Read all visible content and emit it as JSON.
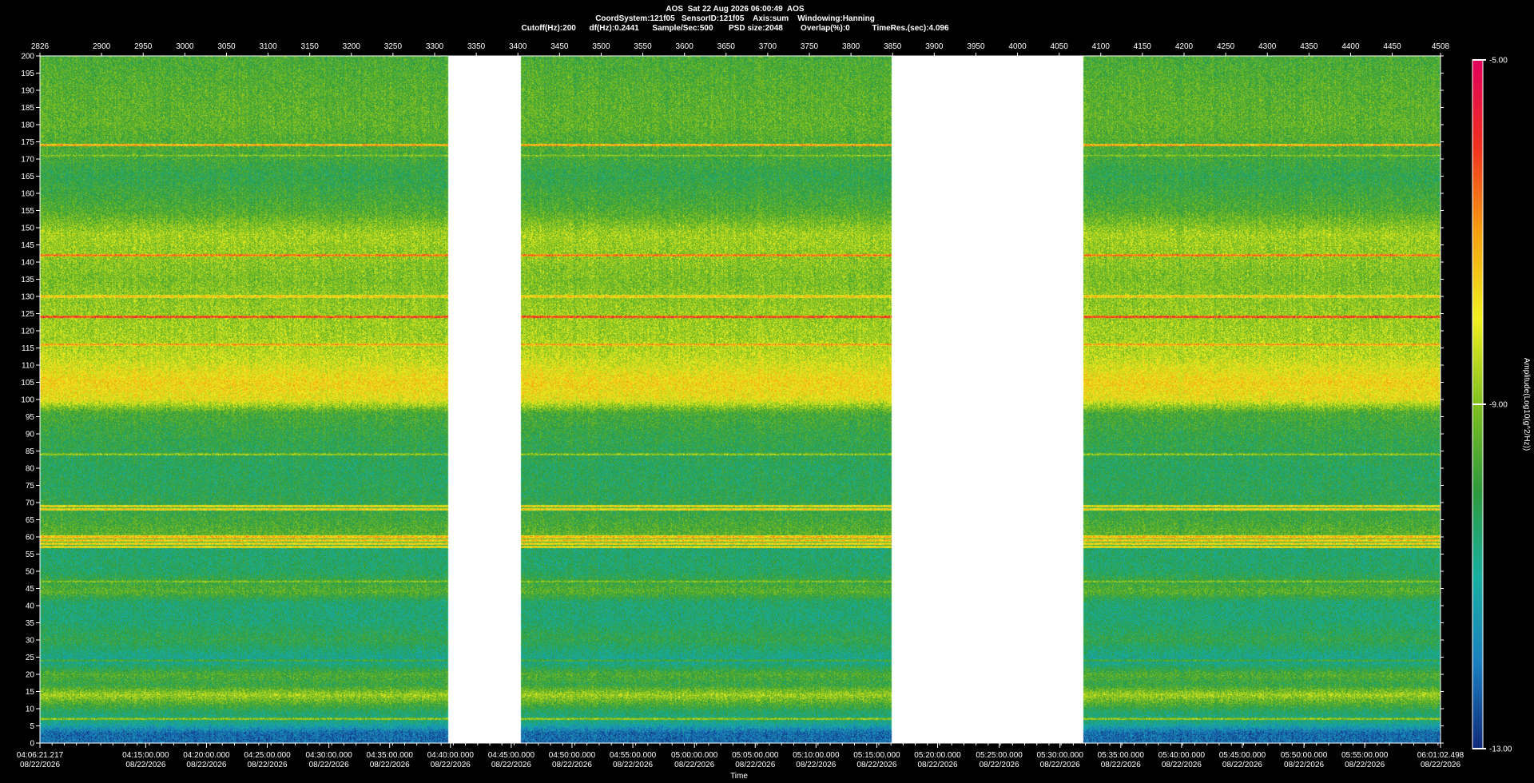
{
  "header": {
    "line1": "AOS  Sat 22 Aug 2026 06:00:49  AOS",
    "line2": "CoordSystem:121f05   SensorID:121f05    Axis:sum    Windowing:Hanning",
    "line3": "Cutoff(Hz):200      df(Hz):0.2441      Sample/Sec:500       PSD size:2048        Overlap(%):0          TimeRes.(sec):4.096"
  },
  "chart_data": {
    "type": "heatmap",
    "title": "AOS  Sat 22 Aug 2026 06:00:49  AOS",
    "xlabel": "Time",
    "ylabel": "",
    "colorbar_label": "Amplitude(Log10(g^2/Hz))",
    "ylim": [
      0,
      200
    ],
    "y_ticks": [
      0,
      5,
      10,
      15,
      20,
      25,
      30,
      35,
      40,
      45,
      50,
      55,
      60,
      65,
      70,
      75,
      80,
      85,
      90,
      95,
      100,
      105,
      110,
      115,
      120,
      125,
      130,
      135,
      140,
      145,
      150,
      155,
      160,
      165,
      170,
      175,
      180,
      185,
      190,
      195,
      200
    ],
    "x_top_range": [
      2826,
      4508
    ],
    "x_top_ticks": [
      "2826",
      "2900",
      "2950",
      "3000",
      "3050",
      "3100",
      "3150",
      "3200",
      "3250",
      "3300",
      "3350",
      "3400",
      "3450",
      "3500",
      "3550",
      "3600",
      "3650",
      "3700",
      "3750",
      "3800",
      "3850",
      "3900",
      "3950",
      "4000",
      "4050",
      "4100",
      "4150",
      "4200",
      "4250",
      "4300",
      "4350",
      "4400",
      "4450",
      "4508"
    ],
    "time_ticks": [
      {
        "time": "04:06:21.217",
        "date": "08/22/2026",
        "index": 2826
      },
      {
        "time": "04:15:00.000",
        "date": "08/22/2026",
        "index": 2953
      },
      {
        "time": "04:20:00.000",
        "date": "08/22/2026",
        "index": 3026
      },
      {
        "time": "04:25:00.000",
        "date": "08/22/2026",
        "index": 3099
      },
      {
        "time": "04:30:00.000",
        "date": "08/22/2026",
        "index": 3173
      },
      {
        "time": "04:35:00.000",
        "date": "08/22/2026",
        "index": 3246
      },
      {
        "time": "04:40:00.000",
        "date": "08/22/2026",
        "index": 3319
      },
      {
        "time": "04:45:00.000",
        "date": "08/22/2026",
        "index": 3392
      },
      {
        "time": "04:50:00.000",
        "date": "08/22/2026",
        "index": 3465
      },
      {
        "time": "04:55:00.000",
        "date": "08/22/2026",
        "index": 3538
      },
      {
        "time": "05:00:00.000",
        "date": "08/22/2026",
        "index": 3612
      },
      {
        "time": "05:05:00.000",
        "date": "08/22/2026",
        "index": 3685
      },
      {
        "time": "05:10:00.000",
        "date": "08/22/2026",
        "index": 3758
      },
      {
        "time": "05:15:00.000",
        "date": "08/22/2026",
        "index": 3831
      },
      {
        "time": "05:20:00.000",
        "date": "08/22/2026",
        "index": 3904
      },
      {
        "time": "05:25:00.000",
        "date": "08/22/2026",
        "index": 3978
      },
      {
        "time": "05:30:00.000",
        "date": "08/22/2026",
        "index": 4051
      },
      {
        "time": "05:35:00.000",
        "date": "08/22/2026",
        "index": 4124
      },
      {
        "time": "05:40:00.000",
        "date": "08/22/2026",
        "index": 4197
      },
      {
        "time": "05:45:00.000",
        "date": "08/22/2026",
        "index": 4270
      },
      {
        "time": "05:50:00.000",
        "date": "08/22/2026",
        "index": 4344
      },
      {
        "time": "05:55:00.000",
        "date": "08/22/2026",
        "index": 4417
      },
      {
        "time": "06:01:02.498",
        "date": "08/22/2026",
        "index": 4508
      }
    ],
    "data_gaps": [
      [
        3316,
        3403
      ],
      [
        3848,
        4079
      ]
    ],
    "color_scale": {
      "min": -13.0,
      "max": -5.0,
      "ticks": [
        "-5.00",
        "-9.00",
        "-13.00"
      ],
      "colors": [
        "#102a7a",
        "#1a7fc0",
        "#18b0a0",
        "#2e9a3c",
        "#80c020",
        "#f2f020",
        "#f5a010",
        "#f03020",
        "#e0005a"
      ]
    },
    "band_profile": [
      {
        "f": 0,
        "v": -12.2
      },
      {
        "f": 3,
        "v": -12.2
      },
      {
        "f": 6,
        "v": -10.8
      },
      {
        "f": 9,
        "v": -10.4
      },
      {
        "f": 12,
        "v": -9.4
      },
      {
        "f": 14,
        "v": -8.7
      },
      {
        "f": 17,
        "v": -10.0
      },
      {
        "f": 20,
        "v": -9.6
      },
      {
        "f": 24,
        "v": -11.0
      },
      {
        "f": 30,
        "v": -10.1
      },
      {
        "f": 36,
        "v": -10.6
      },
      {
        "f": 41,
        "v": -10.5
      },
      {
        "f": 44,
        "v": -9.5
      },
      {
        "f": 50,
        "v": -10.4
      },
      {
        "f": 56,
        "v": -10.5
      },
      {
        "f": 60,
        "v": -9.4
      },
      {
        "f": 65,
        "v": -9.8
      },
      {
        "f": 72,
        "v": -10.2
      },
      {
        "f": 80,
        "v": -10.3
      },
      {
        "f": 90,
        "v": -10.0
      },
      {
        "f": 96,
        "v": -9.7
      },
      {
        "f": 100,
        "v": -8.0
      },
      {
        "f": 105,
        "v": -7.7
      },
      {
        "f": 112,
        "v": -8.4
      },
      {
        "f": 118,
        "v": -8.7
      },
      {
        "f": 125,
        "v": -8.8
      },
      {
        "f": 135,
        "v": -9.1
      },
      {
        "f": 141,
        "v": -8.9
      },
      {
        "f": 148,
        "v": -8.7
      },
      {
        "f": 155,
        "v": -9.6
      },
      {
        "f": 165,
        "v": -10.1
      },
      {
        "f": 172,
        "v": -9.7
      },
      {
        "f": 180,
        "v": -9.4
      },
      {
        "f": 190,
        "v": -9.5
      },
      {
        "f": 200,
        "v": -9.7
      }
    ],
    "lines": [
      {
        "f": 174,
        "v": -6.8
      },
      {
        "f": 171,
        "v": -8.8
      },
      {
        "f": 142,
        "v": -6.4
      },
      {
        "f": 136,
        "v": -8.8
      },
      {
        "f": 130,
        "v": -7.2
      },
      {
        "f": 124,
        "v": -5.8
      },
      {
        "f": 116,
        "v": -6.8
      },
      {
        "f": 84,
        "v": -8.6
      },
      {
        "f": 69,
        "v": -7.6
      },
      {
        "f": 68,
        "v": -7.4
      },
      {
        "f": 60,
        "v": -7.0
      },
      {
        "f": 59,
        "v": -7.2
      },
      {
        "f": 58,
        "v": -7.5
      },
      {
        "f": 57,
        "v": -7.5
      },
      {
        "f": 47,
        "v": -8.8
      },
      {
        "f": 24,
        "v": -9.5
      },
      {
        "f": 7,
        "v": -8.6
      }
    ]
  }
}
